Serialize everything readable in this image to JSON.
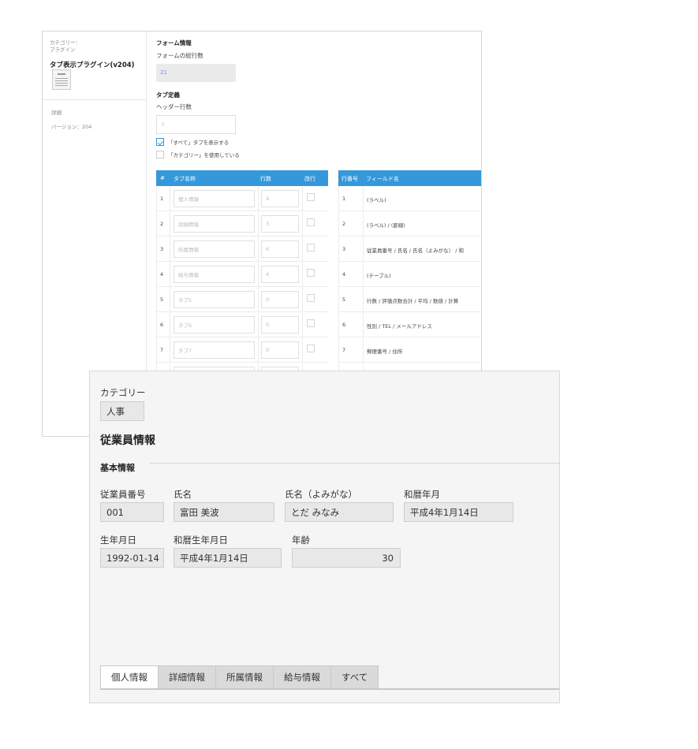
{
  "settings": {
    "sidebar": {
      "category_label": "カテゴリー：",
      "category_value": "プラグイン",
      "plugin_name": "タブ表示プラグイン(v204)",
      "detail_label": "詳細",
      "version": "バージョン：204"
    },
    "form_info": {
      "heading": "フォーム情報",
      "total_rows_label": "フォームの総行数",
      "total_rows_value": "21"
    },
    "tab_def": {
      "heading": "タブ定義",
      "header_rows_label": "ヘッダー行数",
      "header_rows_value": "3",
      "show_all_label": "「すべて」タブを表示する",
      "show_all_checked": true,
      "use_category_label": "「カテゴリー」を使用している",
      "use_category_checked": false
    },
    "tabs_table": {
      "headers": {
        "no": "#",
        "name": "タブ名称",
        "rows": "行数",
        "newline": "改行"
      },
      "rows": [
        {
          "no": "1",
          "name": "個人情報",
          "rows": "4"
        },
        {
          "no": "2",
          "name": "詳細情報",
          "rows": "3"
        },
        {
          "no": "3",
          "name": "所属情報",
          "rows": "6"
        },
        {
          "no": "4",
          "name": "給与情報",
          "rows": "4"
        },
        {
          "no": "5",
          "name": "タブ5",
          "rows": "0"
        },
        {
          "no": "6",
          "name": "タブ6",
          "rows": "0"
        },
        {
          "no": "7",
          "name": "タブ7",
          "rows": "0"
        }
      ]
    },
    "fields_table": {
      "headers": {
        "no": "行番号",
        "field": "フィールド名"
      },
      "rows": [
        {
          "no": "1",
          "field": "(ラベル)"
        },
        {
          "no": "2",
          "field": "(ラベル) / (罫線)"
        },
        {
          "no": "3",
          "field": "従業員番号 / 氏名 / 氏名（よみがな） / 和"
        },
        {
          "no": "4",
          "field": "(テーブル)"
        },
        {
          "no": "5",
          "field": "行数 / 評価点数合計 / 平均 / 数値 / 計算"
        },
        {
          "no": "6",
          "field": "性別 / TEL / メールアドレス"
        },
        {
          "no": "7",
          "field": "郵便番号 / 住所"
        }
      ]
    }
  },
  "record": {
    "category_label": "カテゴリー",
    "category_value": "人事",
    "title": "従業員情報",
    "section_label": "基本情報",
    "fields": {
      "employee_no_label": "従業員番号",
      "employee_no": "001",
      "name_label": "氏名",
      "name": "富田 美波",
      "kana_label": "氏名（よみがな）",
      "kana": "とだ みなみ",
      "wareki_label": "和暦年月",
      "wareki": "平成4年1月14日",
      "birth_label": "生年月日",
      "birth": "1992-01-14",
      "wareki_birth_label": "和暦生年月日",
      "wareki_birth": "平成4年1月14日",
      "age_label": "年齢",
      "age": "30"
    },
    "tabs": [
      "個人情報",
      "詳細情報",
      "所属情報",
      "給与情報",
      "すべて"
    ],
    "active_tab": "個人情報"
  }
}
